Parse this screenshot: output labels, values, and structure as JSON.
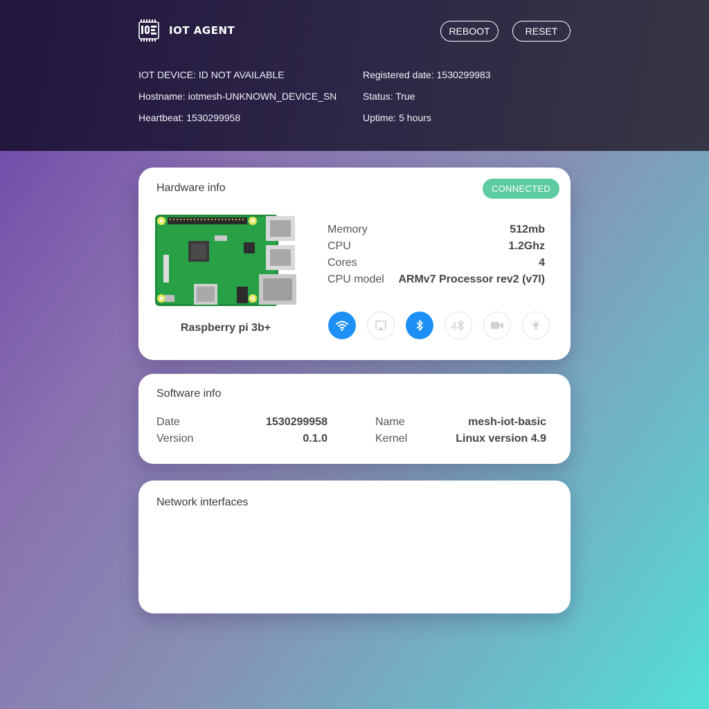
{
  "header": {
    "app_title": "IOT AGENT",
    "reboot_label": "REBOOT",
    "reset_label": "RESET",
    "device_id": "IOT DEVICE: ID NOT AVAILABLE",
    "hostname": "Hostname: iotmesh-UNKNOWN_DEVICE_SN",
    "heartbeat": "Heartbeat: 1530299958",
    "registered_date": "Registered date: 1530299983",
    "status": "Status: True",
    "uptime": "Uptime: 5 hours"
  },
  "hardware": {
    "title": "Hardware info",
    "badge": "CONNECTED",
    "board_name": "Raspberry pi 3b+",
    "specs": [
      {
        "label": "Memory",
        "value": "512mb"
      },
      {
        "label": "CPU",
        "value": "1.2Ghz"
      },
      {
        "label": "Cores",
        "value": "4"
      },
      {
        "label": "CPU model",
        "value": "ARMv7 Processor rev2 (v7l)"
      }
    ],
    "features": [
      {
        "icon": "wifi-icon",
        "active": true
      },
      {
        "icon": "airplay-icon",
        "active": false
      },
      {
        "icon": "bluetooth-icon",
        "active": true
      },
      {
        "icon": "bluetooth-4-icon",
        "active": false
      },
      {
        "icon": "camera-icon",
        "active": false
      },
      {
        "icon": "light-icon",
        "active": false
      }
    ]
  },
  "software": {
    "title": "Software info",
    "date_label": "Date",
    "date_value": "1530299958",
    "version_label": "Version",
    "version_value": "0.1.0",
    "name_label": "Name",
    "name_value": "mesh-iot-basic",
    "kernel_label": "Kernel",
    "kernel_value": "Linux version 4.9"
  },
  "network": {
    "title": "Network interfaces"
  },
  "colors": {
    "accent": "#1e90f5",
    "connected": "#5dcca0",
    "header_bg": "#2a2142"
  }
}
